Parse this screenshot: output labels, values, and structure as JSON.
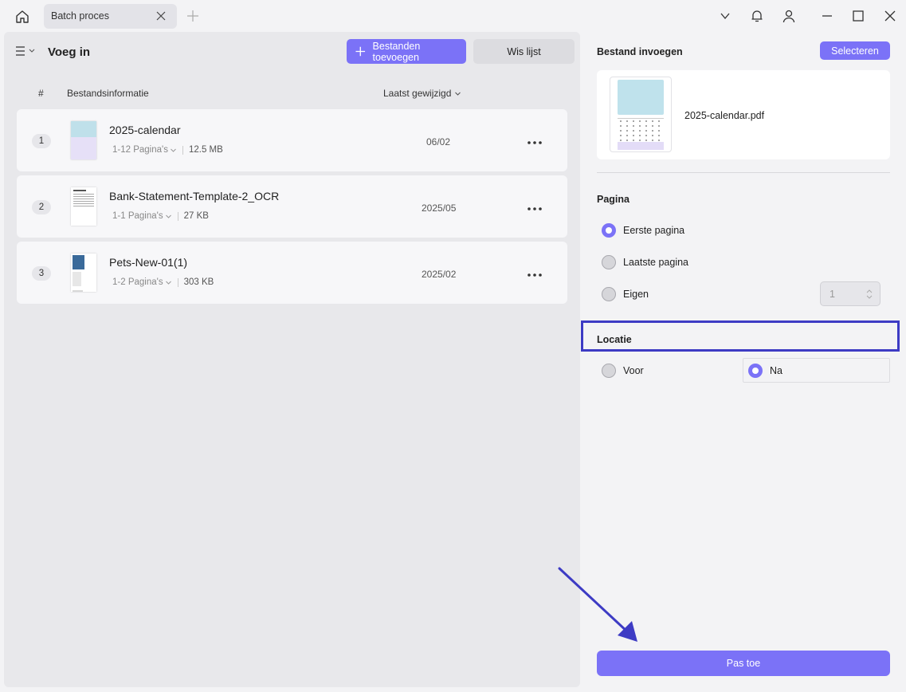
{
  "titlebar": {
    "tab_label": "Batch proces",
    "icons": [
      "home-icon",
      "close-icon",
      "plus-icon",
      "chevron-down-icon",
      "bell-icon",
      "user-icon",
      "minimize-icon",
      "maximize-icon",
      "close-icon"
    ]
  },
  "left_panel": {
    "title": "Voeg in",
    "add_files_label": "Bestanden toevoegen",
    "clear_list_label": "Wis lijst",
    "columns": {
      "number": "#",
      "info": "Bestandsinformatie",
      "modified": "Laatst gewijzigd"
    },
    "files": [
      {
        "num": "1",
        "name": "2025-calendar",
        "pages": "1-12 Pagina's",
        "size": "12.5 MB",
        "date": "06/02"
      },
      {
        "num": "2",
        "name": "Bank-Statement-Template-2_OCR",
        "pages": "1-1 Pagina's",
        "size": "27 KB",
        "date": "2025/05"
      },
      {
        "num": "3",
        "name": "Pets-New-01(1)",
        "pages": "1-2 Pagina's",
        "size": "303 KB",
        "date": "2025/02"
      }
    ]
  },
  "right_panel": {
    "title": "Bestand invoegen",
    "select_label": "Selecteren",
    "preview_filename": "2025-calendar.pdf",
    "page_section": "Pagina",
    "page_options": {
      "first": "Eerste pagina",
      "last": "Laatste pagina",
      "custom": "Eigen"
    },
    "page_selected": "first",
    "custom_value": "1",
    "location_section": "Locatie",
    "location_options": {
      "before": "Voor",
      "after": "Na"
    },
    "location_selected": "after",
    "apply_label": "Pas toe"
  },
  "colors": {
    "accent": "#7b72f7",
    "annotation": "#3d3bc4",
    "panel_bg": "#e8e8eb",
    "row_bg": "#f7f7f9"
  }
}
